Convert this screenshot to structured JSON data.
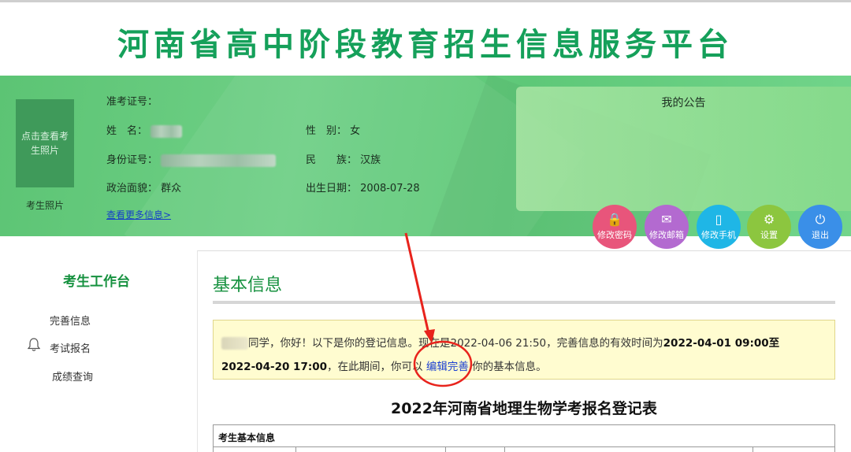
{
  "site": {
    "title": "河南省高中阶段教育招生信息服务平台"
  },
  "profile": {
    "photo_placeholder": "点击查看考生照片",
    "photo_caption": "考生照片",
    "ticket_label": "准考证号：",
    "name_label": "姓　名：",
    "id_label": "身份证号：",
    "politics_label": "政治面貌：",
    "politics_value": "群众",
    "gender_label": "性　别：",
    "gender_value": "女",
    "ethnicity_label": "民　　族：",
    "ethnicity_value": "汉族",
    "birth_label": "出生日期：",
    "birth_value": "2008-07-28",
    "more_link": "查看更多信息>"
  },
  "notice": {
    "title": "我的公告"
  },
  "actions": [
    {
      "label": "修改密码",
      "icon": "lock-icon",
      "glyph": "🔒",
      "color": "#e8557b"
    },
    {
      "label": "修改邮箱",
      "icon": "mail-icon",
      "glyph": "✉",
      "color": "#b36ad0"
    },
    {
      "label": "修改手机",
      "icon": "phone-icon",
      "glyph": "▯",
      "color": "#1fb6e6"
    },
    {
      "label": "设置",
      "icon": "gear-icon",
      "glyph": "⚙",
      "color": "#8cc63f"
    },
    {
      "label": "退出",
      "icon": "power-icon",
      "glyph": "⏻",
      "color": "#3a8fe8"
    }
  ],
  "sidebar": {
    "title": "考生工作台",
    "items": [
      "完善信息",
      "考试报名",
      "成绩查询"
    ]
  },
  "content": {
    "title": "基本信息",
    "alert": {
      "suffix_greeting": "同学，你好！以下是你的登记信息。现在是2022-04-06 21:50，完善信息的有效时间为",
      "start_time": "2022-04-01 09:00至",
      "end_time": "2022-04-20 17:00",
      "middle": "，在此期间，你可以",
      "edit_link": "编辑完善",
      "tail": "你的基本信息。"
    },
    "form_title": "2022年河南省地理生物学考报名登记表",
    "table_section": "考生基本信息"
  }
}
